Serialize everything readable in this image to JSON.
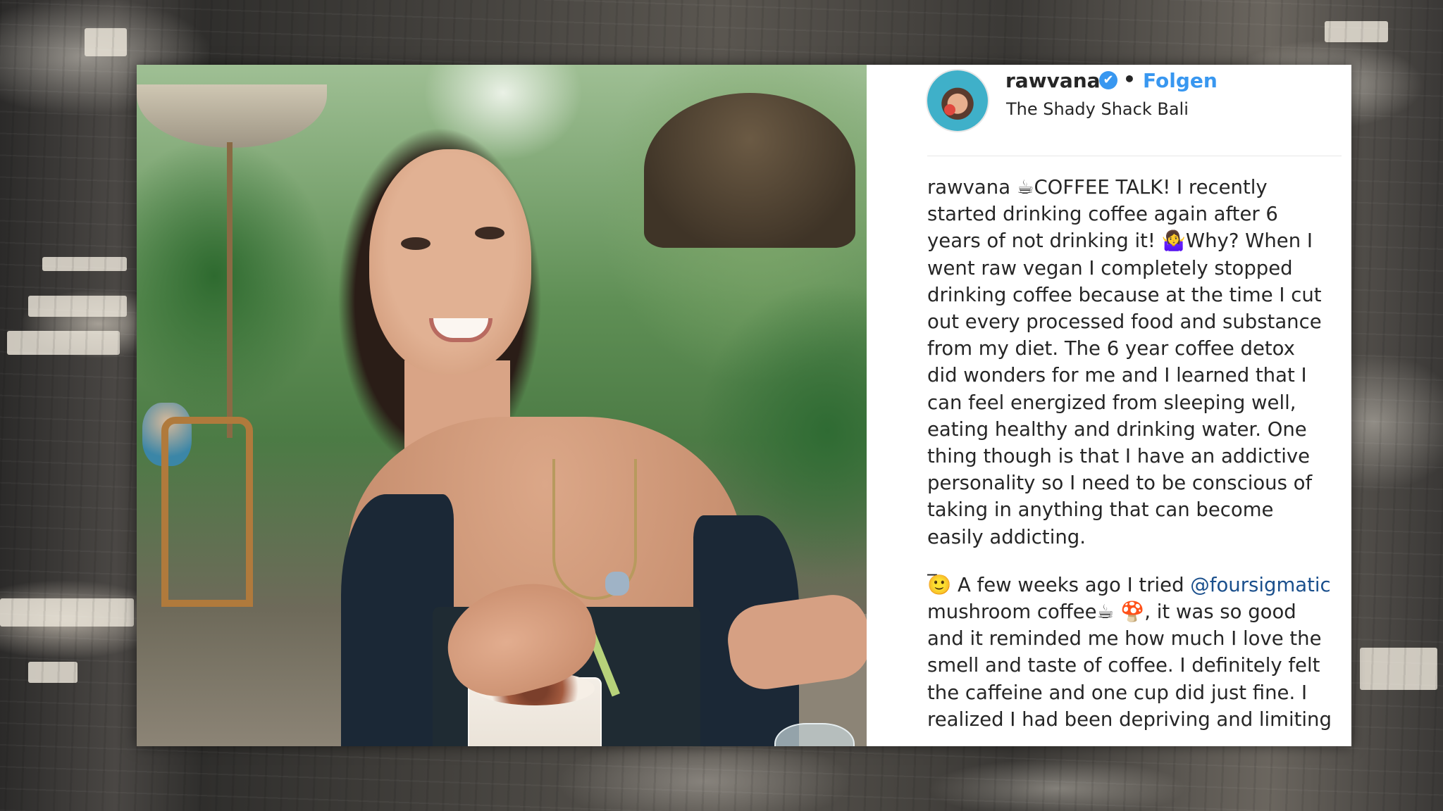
{
  "post": {
    "header": {
      "username": "rawvana",
      "verified_badge": "✔",
      "separator": "•",
      "follow_label": "Folgen",
      "location": "The Shady Shack Bali"
    },
    "caption": {
      "user": "rawvana",
      "coffee_emoji": "☕",
      "line1": "COFFEE TALK! I recently",
      "line2": "started drinking coffee again after 6",
      "line3a": "years of not drinking it!",
      "shrug_emoji": "🤷‍♀️",
      "line3b": "Why? When I",
      "line4": "went raw vegan I completely stopped",
      "line5": "drinking coffee because at the time I cut",
      "line6": "out every processed food and substance",
      "line7": "from my diet. The 6 year coffee detox",
      "line8": "did wonders for me and I learned that I",
      "line9": "can feel energized from sleeping well,",
      "line10": "eating healthy and drinking water. One",
      "line11": "thing though is that I have an addictive",
      "line12": "personality so I need to be conscious of",
      "line13": "taking in anything that can become",
      "line14": "easily addicting.",
      "dash": "_",
      "smile_emoji": "🙂",
      "line15a": "A few weeks ago I tried",
      "mention": "@foursigmatic",
      "line16a": "mushroom coffee",
      "mushroom_emoji": "🍄",
      "line16b": ", it was so good",
      "line17": "and it reminded me how much I love the",
      "line18": "smell and taste of coffee. I definitely felt",
      "line19": "the caffeine and one cup did just fine. I",
      "line20": "realized I had been depriving and limiting"
    }
  }
}
